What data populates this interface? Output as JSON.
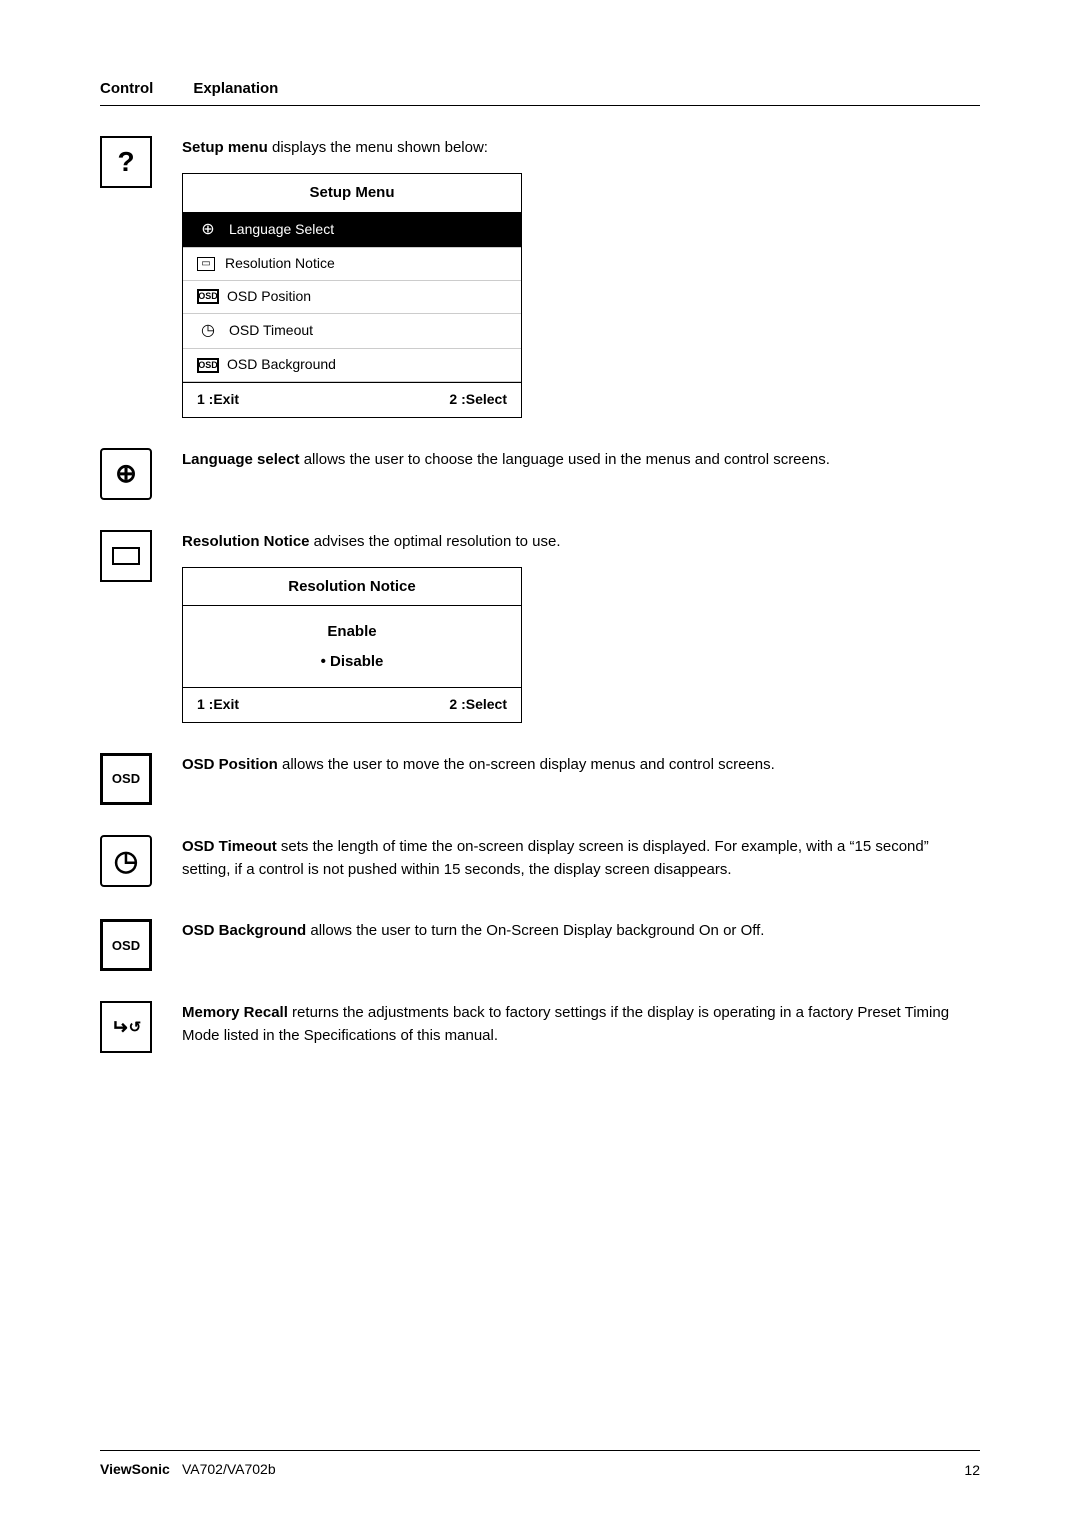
{
  "header": {
    "control_label": "Control",
    "explanation_label": "Explanation"
  },
  "rows": [
    {
      "id": "setup-menu-row",
      "icon_type": "question",
      "icon_symbol": "?",
      "text_before": "Setup menu",
      "text_before_bold": true,
      "text_after": " displays the menu shown below:",
      "has_menu_table": true
    },
    {
      "id": "language-select-row",
      "icon_type": "globe",
      "icon_symbol": "⊕",
      "text_before": "Language select",
      "text_before_bold": true,
      "text_after": " allows the user to choose the language used in the menus and control screens.",
      "has_menu_table": false
    },
    {
      "id": "resolution-notice-row",
      "icon_type": "rect",
      "icon_symbol": "▭",
      "text_before": "Resolution Notice",
      "text_before_bold": true,
      "text_after": " advises the optimal resolution to use.",
      "has_res_table": true
    },
    {
      "id": "osd-position-row",
      "icon_type": "osd",
      "icon_symbol": "OSD",
      "text_before": "OSD Position",
      "text_before_bold": true,
      "text_after": " allows the user to move the on-screen display menus and control screens."
    },
    {
      "id": "osd-timeout-row",
      "icon_type": "clock",
      "icon_symbol": "◷",
      "text_before": "OSD Timeout",
      "text_before_bold": true,
      "text_after": " sets the length of time the on-screen display screen is displayed. For example, with a “15 second” setting, if a control is not pushed within 15 seconds, the display screen disappears."
    },
    {
      "id": "osd-background-row",
      "icon_type": "osd",
      "icon_symbol": "OSD",
      "text_before": "OSD Background",
      "text_before_bold": true,
      "text_after": " allows the user to turn the On-Screen Display background On or Off."
    },
    {
      "id": "memory-recall-row",
      "icon_type": "memory",
      "icon_symbol": "↓↺",
      "text_before": "Memory Recall",
      "text_before_bold": true,
      "text_after": " returns the adjustments back to factory settings if the display is operating in a factory Preset Timing Mode listed in the Specifications of this manual."
    }
  ],
  "setup_menu": {
    "title": "Setup Menu",
    "items": [
      {
        "icon": "⊕",
        "label": "Language Select",
        "highlighted": true
      },
      {
        "icon": "▭",
        "label": "Resolution Notice",
        "highlighted": false
      },
      {
        "icon": "OSD",
        "label": "OSD Position",
        "highlighted": false
      },
      {
        "icon": "◷",
        "label": "OSD Timeout",
        "highlighted": false
      },
      {
        "icon": "OSD",
        "label": "OSD Background",
        "highlighted": false
      }
    ],
    "footer_exit": "1 :Exit",
    "footer_select": "2 :Select"
  },
  "resolution_notice": {
    "title": "Resolution Notice",
    "enable_label": "Enable",
    "disable_label": "• Disable",
    "footer_exit": "1 :Exit",
    "footer_select": "2 :Select"
  },
  "footer": {
    "brand": "ViewSonic",
    "model": "VA702/VA702b",
    "page_number": "12"
  }
}
